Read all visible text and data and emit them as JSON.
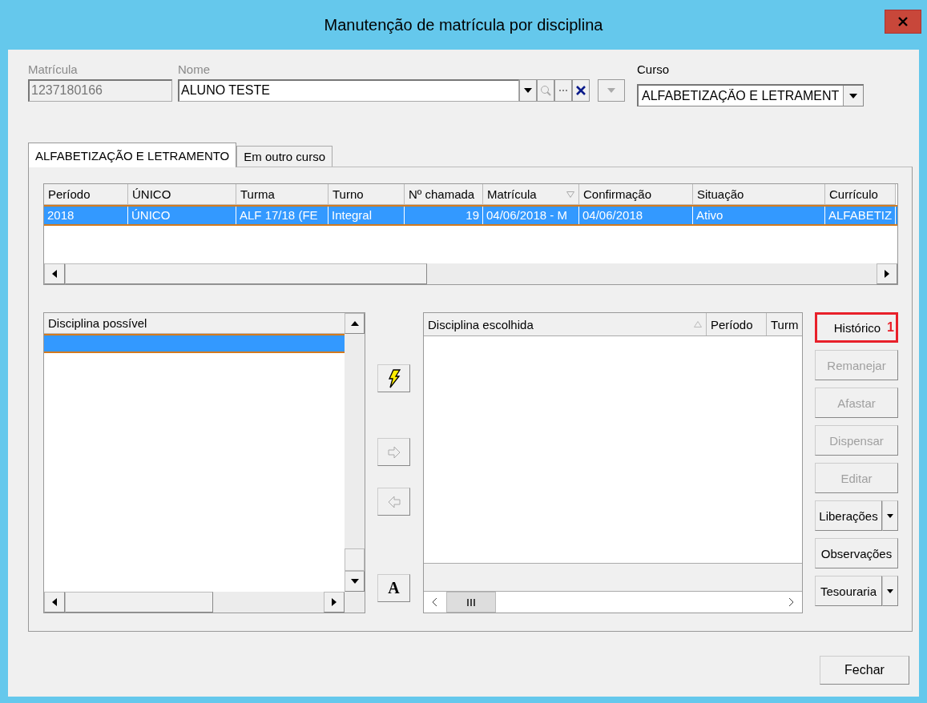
{
  "window": {
    "title": "Manutenção de matrícula por disciplina"
  },
  "fields": {
    "matricula": {
      "label": "Matrícula",
      "value": "1237180166",
      "disabled": true
    },
    "nome": {
      "label": "Nome",
      "value": "ALUNO TESTE"
    },
    "curso": {
      "label": "Curso",
      "value": "ALFABETIZAÇÃO E LETRAMENT"
    }
  },
  "tabs": [
    {
      "label": "ALFABETIZAÇÃO E LETRAMENTO",
      "selected": true
    },
    {
      "label": "Em outro curso",
      "selected": false
    }
  ],
  "enrollment_table": {
    "columns": [
      {
        "label": "Período"
      },
      {
        "label": "ÚNICO"
      },
      {
        "label": "Turma"
      },
      {
        "label": "Turno"
      },
      {
        "label": "Nº chamada"
      },
      {
        "label": "Matrícula",
        "sort_descending": true
      },
      {
        "label": "Confirmação"
      },
      {
        "label": "Situação"
      },
      {
        "label": "Currículo"
      }
    ],
    "rows": [
      {
        "selected": true,
        "cells": [
          "2018",
          "ÚNICO",
          "ALF 17/18  (FE",
          "Integral",
          "19",
          "04/06/2018 - M",
          "04/06/2018",
          "Ativo",
          "ALFABETIZ"
        ]
      }
    ]
  },
  "available_list": {
    "header": "Disciplina possível",
    "rows": [
      {
        "selected": true
      }
    ]
  },
  "move_buttons": [
    {
      "kind": "lightning",
      "disabled": false
    },
    {
      "kind": "right",
      "disabled": true
    },
    {
      "kind": "left",
      "disabled": true
    },
    {
      "kind": "font",
      "label": "A",
      "disabled": false
    }
  ],
  "chosen_list": {
    "columns": [
      {
        "label": "Disciplina escolhida",
        "sort_ascending": true
      },
      {
        "label": "Período"
      },
      {
        "label": "Turm"
      }
    ]
  },
  "side_buttons": [
    {
      "label": "Histórico",
      "disabled": false,
      "highlighted": true,
      "badge": "1"
    },
    {
      "label": "Remanejar",
      "disabled": true
    },
    {
      "label": "Afastar",
      "disabled": true
    },
    {
      "label": "Dispensar",
      "disabled": true
    },
    {
      "label": "Editar",
      "disabled": true
    },
    {
      "label": "Liberações",
      "disabled": false,
      "kind": "split"
    },
    {
      "label": "Observações",
      "disabled": false
    },
    {
      "label": "Tesouraria",
      "disabled": false,
      "kind": "split"
    }
  ],
  "footer_buttons": [
    {
      "label": "Fechar"
    }
  ]
}
